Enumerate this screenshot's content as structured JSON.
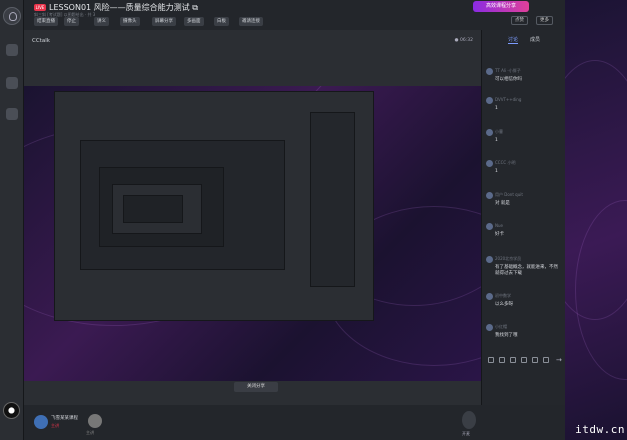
{
  "header": {
    "live_badge": "LIVE",
    "title": "LESSON01 风险——质量综合能力测试 ⧉",
    "subtitle": "斜三斜 [考试题]   以图题给出   · 共 3",
    "toolbar": [
      "结束直播",
      "停止",
      "讲义",
      "摄像头",
      "屏幕分享",
      "多画面",
      "白板",
      "邀请连接"
    ],
    "promo": "高效课程分享",
    "right_buttons": [
      "点赞",
      "更多"
    ]
  },
  "stage": {
    "label": "CCtalk",
    "rec": "● 06:32",
    "close_share": "关闭分享"
  },
  "panel": {
    "tabs": [
      "讨论",
      "成员"
    ],
    "messages": [
      {
        "name": "TT Ali -小胖子",
        "text": "可以相信你吗"
      },
      {
        "name": "DVVT++ding",
        "text": "1"
      },
      {
        "name": "小曹",
        "text": "1"
      },
      {
        "name": "CCCC 小明",
        "text": "1"
      },
      {
        "name": "用户 Dont quit",
        "text": "对 就是"
      },
      {
        "name": "Nue",
        "text": "好卡"
      },
      {
        "name": "2020北京学员",
        "text": "有了基础概念，就能进来，不然就得过去下载"
      },
      {
        "name": "初中数学",
        "text": "以么多呀"
      },
      {
        "name": "小红帽",
        "text": "我找到了哦"
      }
    ]
  },
  "footer": {
    "user1_name": "飞雪某某课程",
    "user1_sub": "主讲",
    "user2_name": "主讲",
    "mic_label": "开麦"
  },
  "watermark": "itdw.cn",
  "colors": {
    "accent": "#7c9cff",
    "live": "#e8344b",
    "promo_a": "#8a2be2",
    "promo_b": "#e0409a"
  }
}
